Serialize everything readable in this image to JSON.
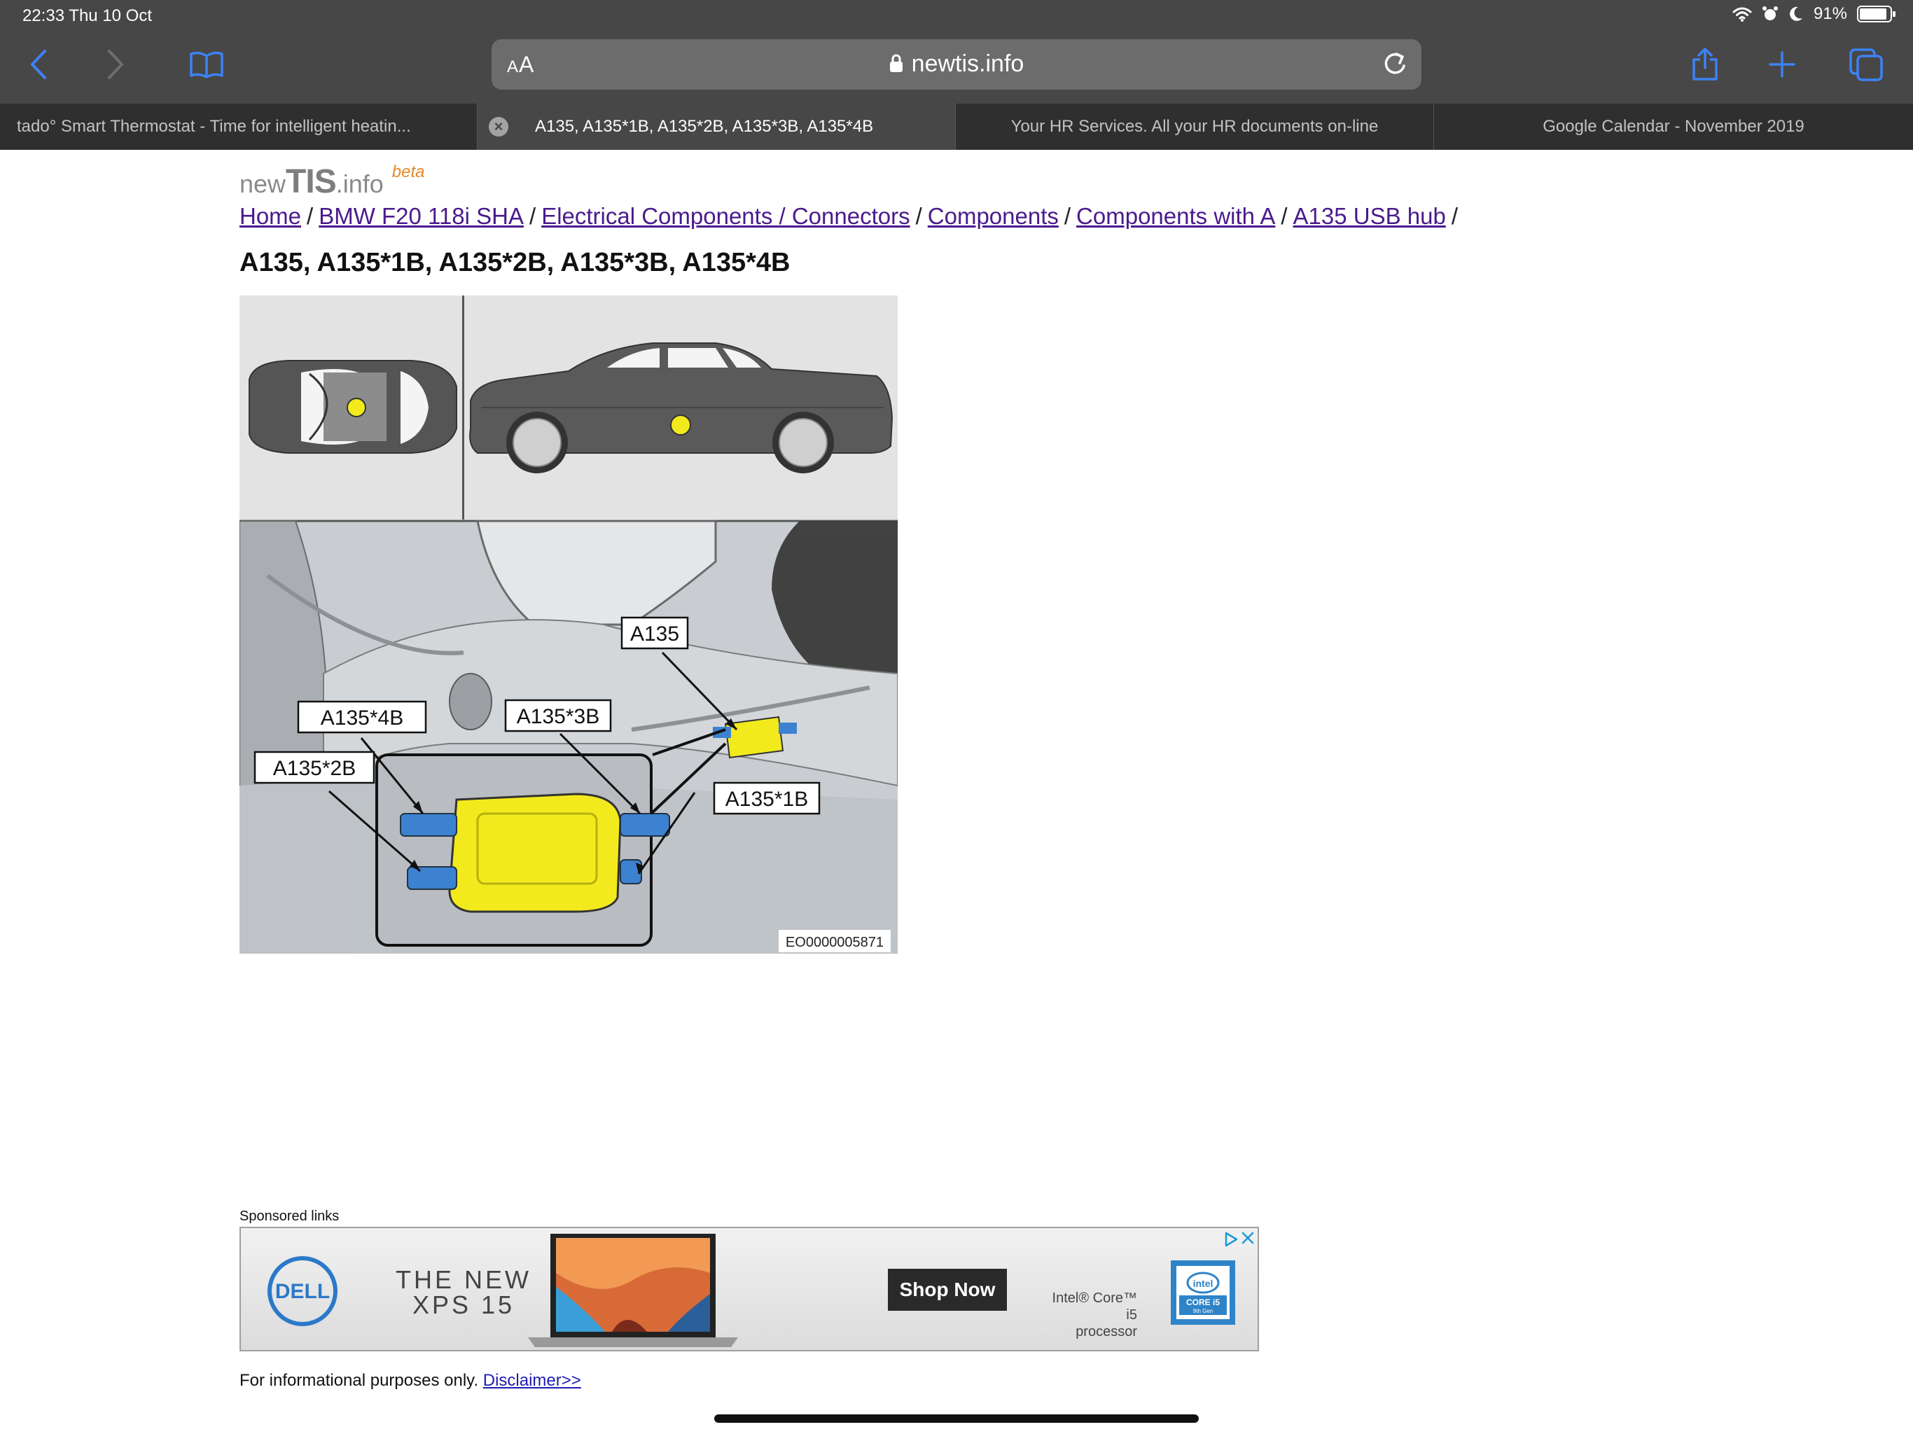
{
  "status": {
    "time_date": "22:33   Thu 10 Oct",
    "battery": "91%",
    "battery_level": 0.91
  },
  "toolbar": {
    "reader_small": "A",
    "reader_big": "A",
    "url": "newtis.info"
  },
  "tabs": [
    {
      "title": "tado° Smart Thermostat - Time for intelligent heatin...",
      "active": false
    },
    {
      "title": "A135, A135*1B, A135*2B, A135*3B, A135*4B",
      "active": true
    },
    {
      "title": "Your HR Services. All your HR documents on-line",
      "active": false
    },
    {
      "title": "Google Calendar - November 2019",
      "active": false
    }
  ],
  "site": {
    "logo_new": "new",
    "logo_tis": "TIS",
    "logo_info": ".info",
    "logo_beta": "beta"
  },
  "breadcrumb": [
    "Home",
    "BMW F20 118i SHA",
    "Electrical Components / Connectors",
    "Components",
    "Components with A",
    "A135 USB hub"
  ],
  "breadcrumb_sep": "/",
  "page_title": "A135, A135*1B, A135*2B, A135*3B, A135*4B",
  "diagram": {
    "labels": [
      "A135",
      "A135*4B",
      "A135*3B",
      "A135*2B",
      "A135*1B"
    ],
    "image_code": "EO0000005871"
  },
  "ad": {
    "sponsored_label": "Sponsored links",
    "brand": "DELL",
    "headline_line1": "THE NEW",
    "headline_line2": "XPS 15",
    "cta": "Shop Now",
    "intel_line1": "Intel® Core™ i5",
    "intel_line2": "processor",
    "badge_top": "intel",
    "badge_mid": "CORE i5",
    "badge_bottom": "9th Gen"
  },
  "footer": {
    "text": "For informational purposes only.",
    "link": "Disclaimer>>"
  },
  "colors": {
    "chrome": "#474747",
    "tabbar": "#2f2f2f",
    "link": "#4a1a8c",
    "accent_blue": "#3b82f6",
    "component_yellow": "#f2ea1c"
  }
}
